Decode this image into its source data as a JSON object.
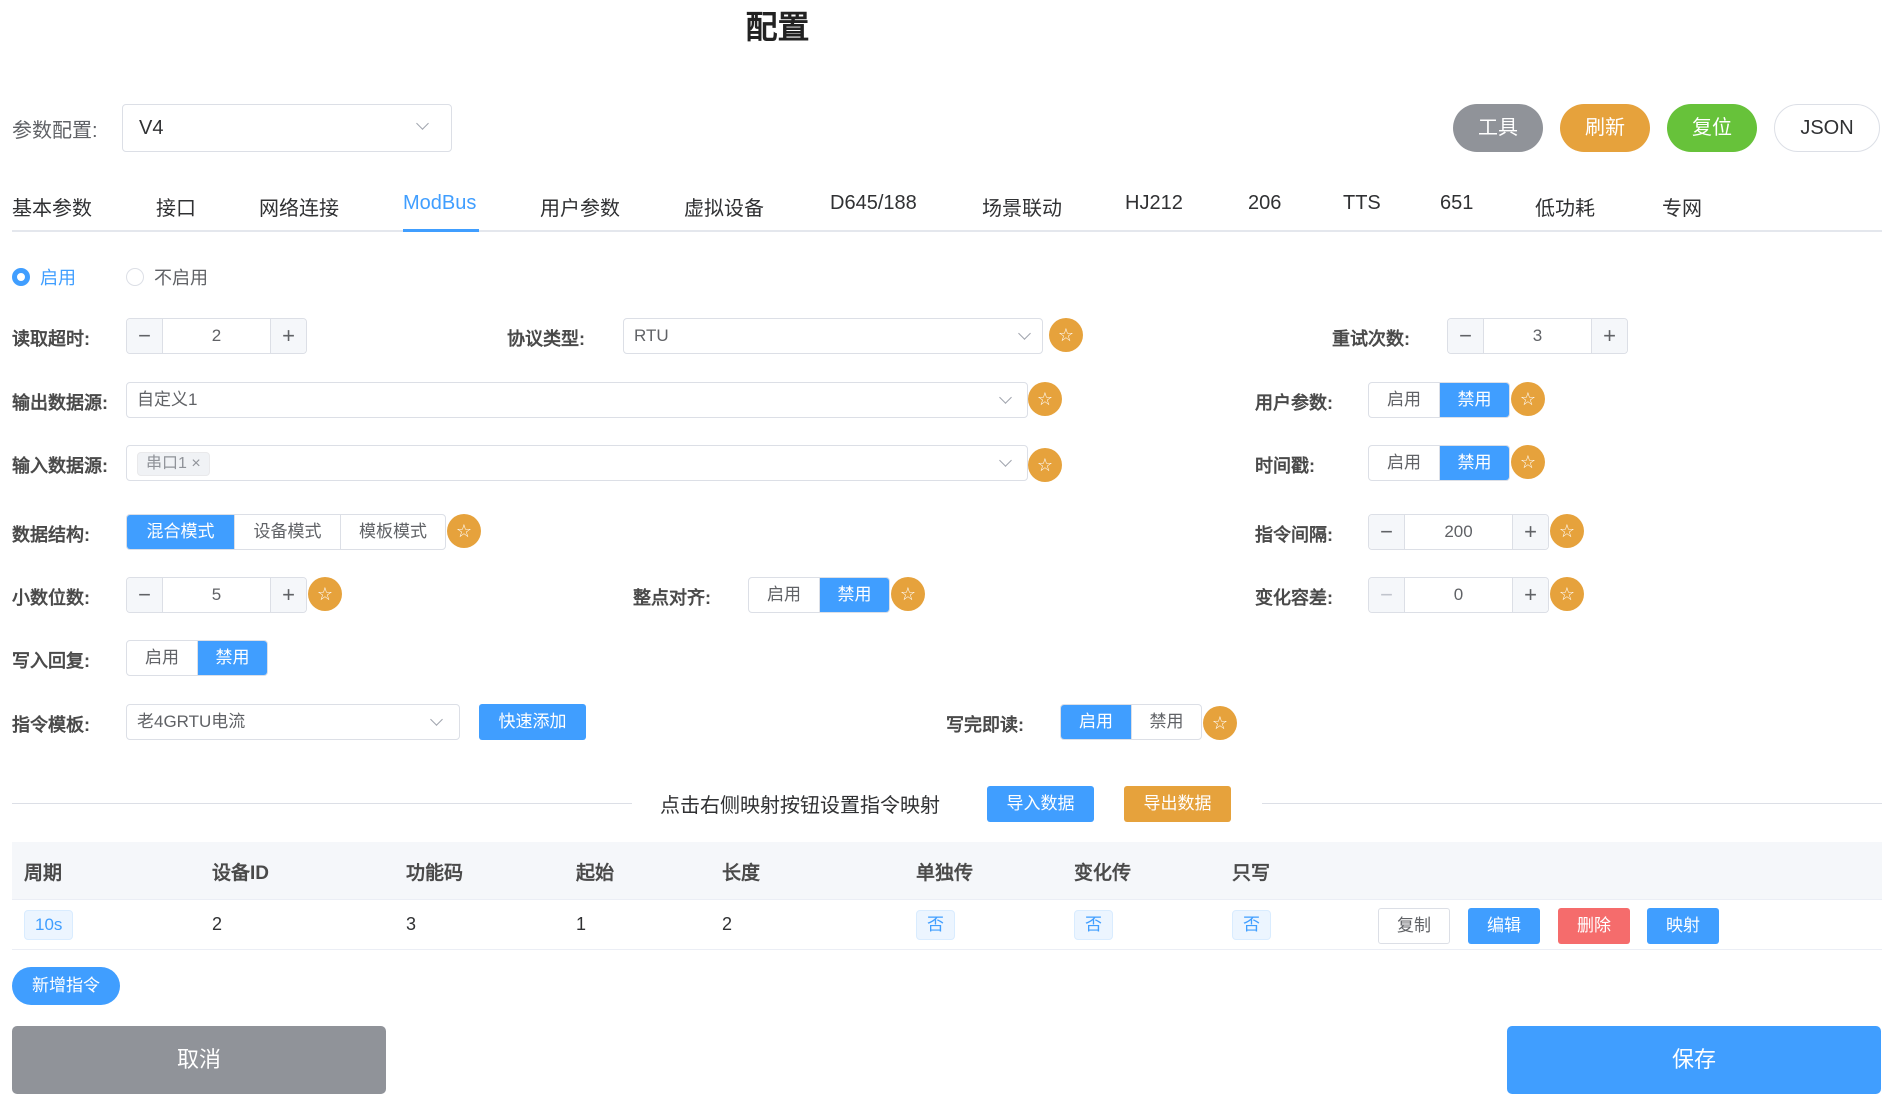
{
  "page_title": "配置",
  "config": {
    "label": "参数配置:",
    "value": "V4"
  },
  "top_buttons": {
    "tools": "工具",
    "refresh": "刷新",
    "reset": "复位",
    "json": "JSON"
  },
  "tabs": [
    "基本参数",
    "接口",
    "网络连接",
    "ModBus",
    "用户参数",
    "虚拟设备",
    "D645/188",
    "场景联动",
    "HJ212",
    "206",
    "TTS",
    "651",
    "低功耗",
    "专网"
  ],
  "active_tab": "ModBus",
  "enable_radio": {
    "on": "启用",
    "off": "不启用",
    "selected": "启用"
  },
  "form": {
    "read_timeout": {
      "label": "读取超时:",
      "value": "2"
    },
    "protocol": {
      "label": "协议类型:",
      "value": "RTU"
    },
    "retry": {
      "label": "重试次数:",
      "value": "3"
    },
    "output_source": {
      "label": "输出数据源:",
      "value": "自定义1"
    },
    "user_params": {
      "label": "用户参数:",
      "options": [
        "启用",
        "禁用"
      ],
      "selected": "禁用"
    },
    "input_source": {
      "label": "输入数据源:",
      "tag": "串口1"
    },
    "timestamp": {
      "label": "时间戳:",
      "options": [
        "启用",
        "禁用"
      ],
      "selected": "禁用"
    },
    "data_structure": {
      "label": "数据结构:",
      "options": [
        "混合模式",
        "设备模式",
        "模板模式"
      ],
      "selected": "混合模式"
    },
    "cmd_interval": {
      "label": "指令间隔:",
      "value": "200"
    },
    "decimals": {
      "label": "小数位数:",
      "value": "5"
    },
    "on_hour_align": {
      "label": "整点对齐:",
      "options": [
        "启用",
        "禁用"
      ],
      "selected": "禁用"
    },
    "change_tolerance": {
      "label": "变化容差:",
      "value": "0"
    },
    "write_reply": {
      "label": "写入回复:",
      "options": [
        "启用",
        "禁用"
      ],
      "selected": "禁用"
    },
    "cmd_template": {
      "label": "指令模板:",
      "value": "老4GRTU电流",
      "quick_add": "快速添加"
    },
    "read_after_write": {
      "label": "写完即读:",
      "options": [
        "启用",
        "禁用"
      ],
      "selected": "启用"
    }
  },
  "mapping": {
    "hint": "点击右侧映射按钮设置指令映射",
    "import": "导入数据",
    "export": "导出数据"
  },
  "table": {
    "headers": [
      "周期",
      "设备ID",
      "功能码",
      "起始",
      "长度",
      "单独传",
      "变化传",
      "只写"
    ],
    "rows": [
      {
        "period": "10s",
        "device_id": "2",
        "func_code": "3",
        "start": "1",
        "length": "2",
        "single": "否",
        "change": "否",
        "write_only": "否"
      }
    ],
    "row_actions": {
      "copy": "复制",
      "edit": "编辑",
      "delete": "删除",
      "map": "映射"
    }
  },
  "add_command": "新增指令",
  "footer": {
    "cancel": "取消",
    "save": "保存"
  },
  "colors": {
    "primary": "#409eff",
    "warning": "#e6a23c",
    "success": "#67c23a",
    "danger": "#f56c6c",
    "info": "#909399"
  },
  "icons": {
    "star": "star-icon",
    "chevron": "chevron-down-icon"
  }
}
